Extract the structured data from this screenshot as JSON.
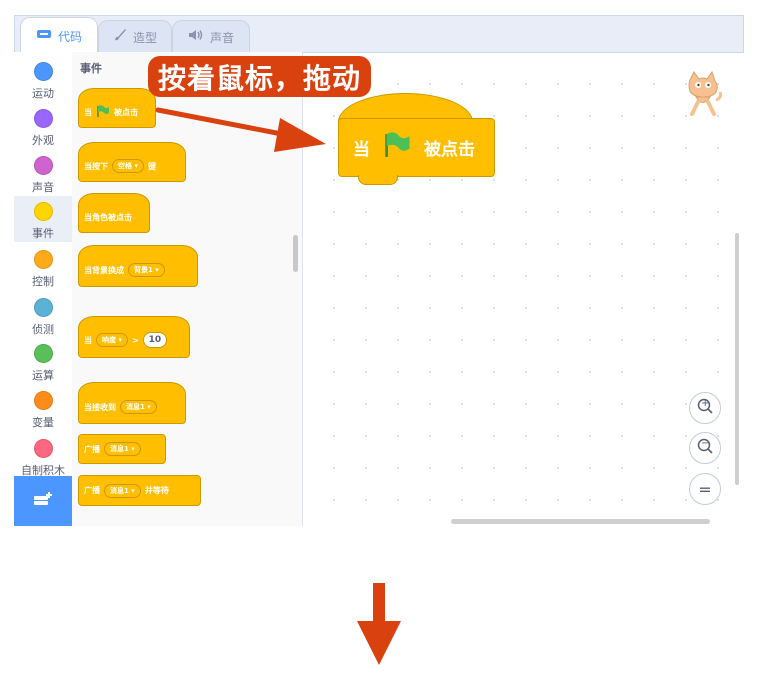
{
  "tabs": [
    {
      "label": "代码",
      "icon": "code-icon"
    },
    {
      "label": "造型",
      "icon": "brush-icon"
    },
    {
      "label": "声音",
      "icon": "speaker-icon"
    }
  ],
  "categories": [
    {
      "label": "运动",
      "color": "#4c97ff"
    },
    {
      "label": "外观",
      "color": "#9966ff"
    },
    {
      "label": "声音",
      "color": "#cf63cf"
    },
    {
      "label": "事件",
      "color": "#ffd500"
    },
    {
      "label": "控制",
      "color": "#ffab19"
    },
    {
      "label": "侦测",
      "color": "#5cb1d6"
    },
    {
      "label": "运算",
      "color": "#59c059"
    },
    {
      "label": "变量",
      "color": "#ff8c1a"
    },
    {
      "label": "自制积木",
      "color": "#ff6680"
    }
  ],
  "palette": {
    "title": "事件",
    "blocks": {
      "flag_click": {
        "pre": "当",
        "post": "被点击"
      },
      "key_press": {
        "pre": "当按下",
        "key": "空格",
        "post": "键"
      },
      "sprite_click": {
        "text": "当角色被点击"
      },
      "backdrop": {
        "pre": "当背景换成",
        "value": "背景1"
      },
      "greater": {
        "pre": "当",
        "sensor": "响度",
        "op": ">",
        "value": "10"
      },
      "receive": {
        "pre": "当接收到",
        "value": "消息1"
      },
      "broadcast": {
        "pre": "广播",
        "value": "消息1"
      },
      "broadcast_wait": {
        "pre": "广播",
        "value": "消息1",
        "post": "并等待"
      }
    }
  },
  "banner": "按着鼠标，拖动",
  "canvas_block": {
    "pre": "当",
    "post": "被点击"
  },
  "zoom": {
    "in": "+",
    "out": "−",
    "reset": "="
  },
  "colors": {
    "accent": "#4c97ff",
    "event": "#ffbf00",
    "arrow": "#d9420f"
  }
}
